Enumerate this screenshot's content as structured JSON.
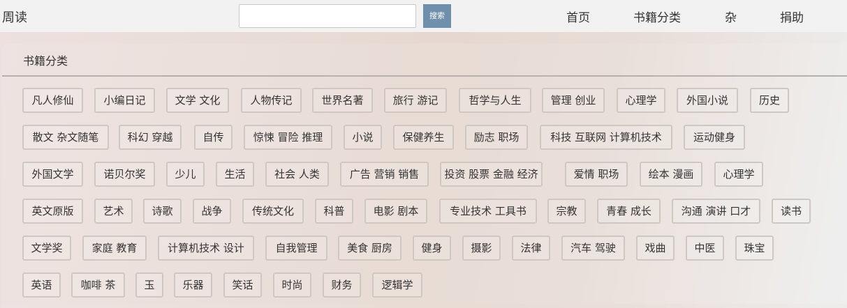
{
  "header": {
    "brand": "周读",
    "search": {
      "value": "",
      "placeholder": "",
      "button_label": "搜索"
    },
    "nav": [
      "首页",
      "书籍分类",
      "杂",
      "捐助"
    ]
  },
  "panel": {
    "title": "书籍分类"
  },
  "categories": [
    [
      "凡人修仙",
      "小编日记",
      "文学 文化",
      "人物传记",
      "世界名著",
      "旅行 游记",
      "哲学与人生",
      "管理 创业",
      "心理学",
      "外国小说",
      "历史"
    ],
    [
      "散文 杂文随笔",
      "科幻 穿越",
      "自传",
      "惊悚 冒险 推理",
      "小说",
      "保健养生",
      "励志 职场",
      "科技 互联网 计算机技术",
      "运动健身"
    ],
    [
      "外国文学",
      "诺贝尔奖",
      "少儿",
      "生活",
      "社会 人类",
      "广告 营销 销售",
      "投资 股票 金融 经济",
      "爱情 职场",
      "绘本 漫画",
      "心理学"
    ],
    [
      "英文原版",
      "艺术",
      "诗歌",
      "战争",
      "传统文化",
      "科普",
      "电影 剧本",
      "专业技术 工具书",
      "宗教",
      "青春 成长",
      "沟通 演讲 口才",
      "读书"
    ],
    [
      "文学奖",
      "家庭 教育",
      "计算机技术 设计",
      "自我管理",
      "美食 厨房",
      "健身",
      "摄影",
      "法律",
      "汽车 驾驶",
      "戏曲",
      "中医",
      "珠宝"
    ],
    [
      "英语",
      "咖啡 茶",
      "玉",
      "乐器",
      "笑话",
      "时尚",
      "财务",
      "逻辑学"
    ]
  ]
}
